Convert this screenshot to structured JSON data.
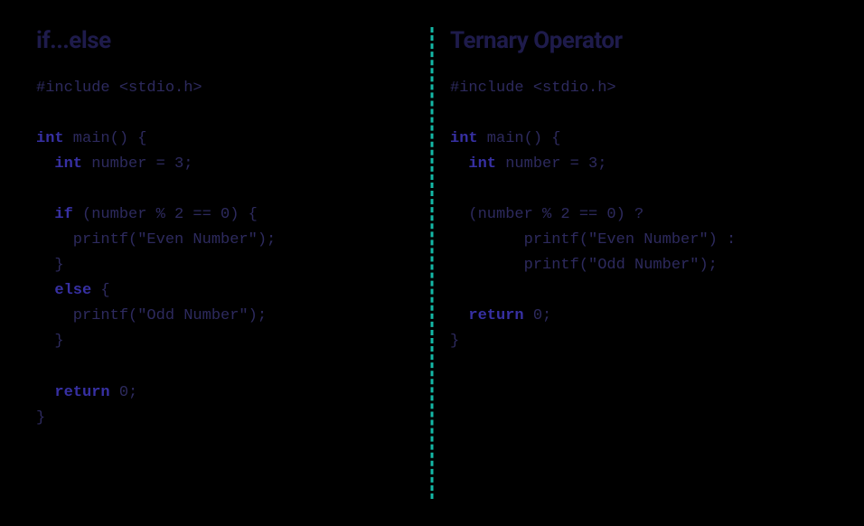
{
  "left": {
    "heading": "if...else",
    "code": {
      "line1": "#include <stdio.h>",
      "line2": "",
      "line3_kw": "int",
      "line3_rest": " main() {",
      "line4_indent": "  ",
      "line4_kw": "int",
      "line4_rest": " number = 3;",
      "line5": "",
      "line6_indent": "  ",
      "line6_kw": "if",
      "line6_rest": " (number % 2 == 0) {",
      "line7": "    printf(\"Even Number\");",
      "line8": "  }",
      "line9_indent": "  ",
      "line9_kw": "else",
      "line9_rest": " {",
      "line10": "    printf(\"Odd Number\");",
      "line11": "  }",
      "line12": "",
      "line13_indent": "  ",
      "line13_kw": "return",
      "line13_rest": " 0;",
      "line14": "}"
    }
  },
  "right": {
    "heading": "Ternary Operator",
    "code": {
      "line1": "#include <stdio.h>",
      "line2": "",
      "line3_kw": "int",
      "line3_rest": " main() {",
      "line4_indent": "  ",
      "line4_kw": "int",
      "line4_rest": " number = 3;",
      "line5": "",
      "line6": "  (number % 2 == 0) ?",
      "line7": "        printf(\"Even Number\") :",
      "line8": "        printf(\"Odd Number\");",
      "line9": "",
      "line10_indent": "  ",
      "line10_kw": "return",
      "line10_rest": " 0;",
      "line11": "}"
    }
  }
}
